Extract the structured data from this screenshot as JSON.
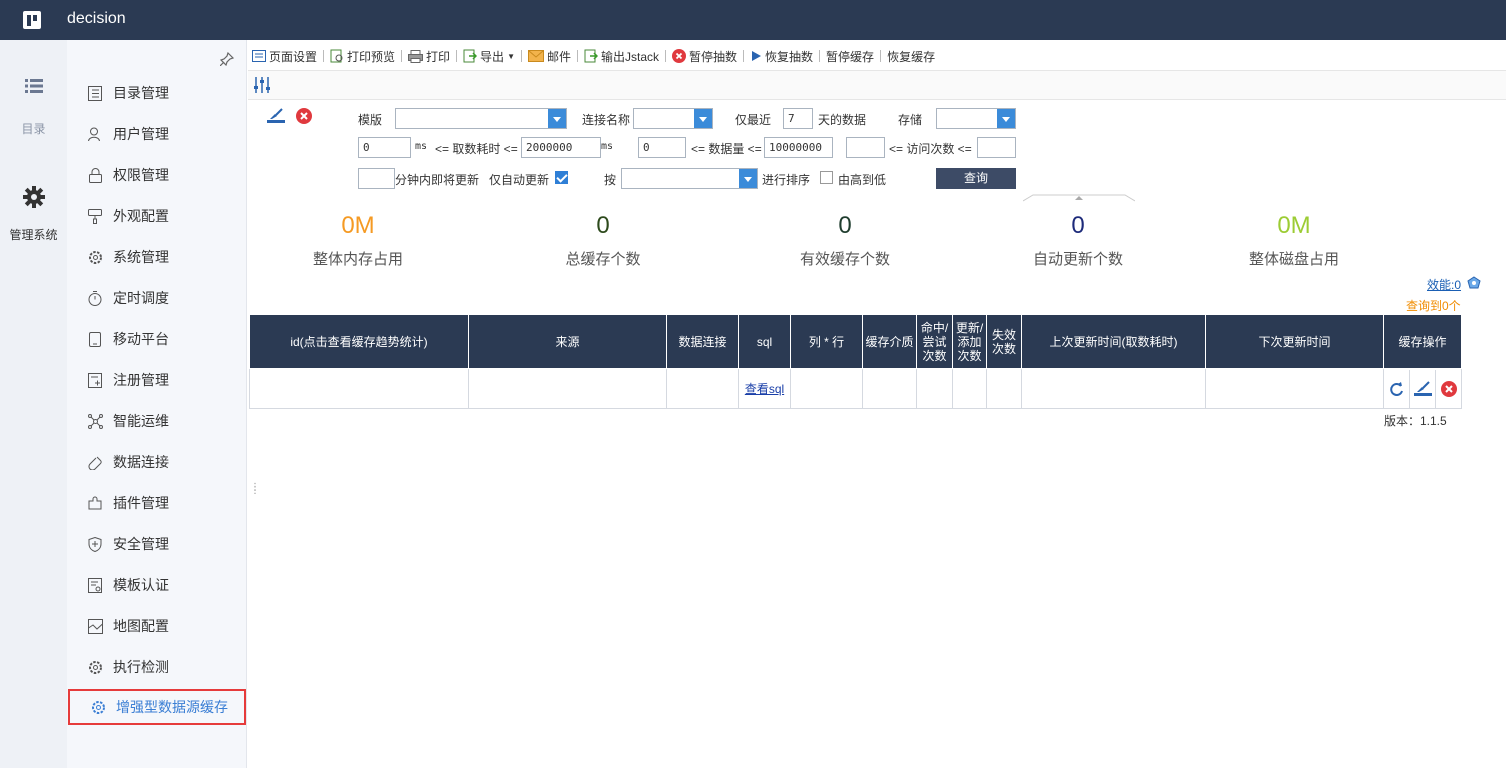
{
  "app": {
    "title": "decision"
  },
  "rail": [
    {
      "label": "目录",
      "icon": "list-icon"
    },
    {
      "label": "管理系统",
      "icon": "gear-icon"
    }
  ],
  "sidebar": {
    "items": [
      {
        "label": "目录管理",
        "icon": "catalog-icon"
      },
      {
        "label": "用户管理",
        "icon": "user-icon"
      },
      {
        "label": "权限管理",
        "icon": "lock-icon"
      },
      {
        "label": "外观配置",
        "icon": "brush-icon"
      },
      {
        "label": "系统管理",
        "icon": "settings-icon"
      },
      {
        "label": "定时调度",
        "icon": "timer-icon"
      },
      {
        "label": "移动平台",
        "icon": "mobile-icon"
      },
      {
        "label": "注册管理",
        "icon": "register-icon"
      },
      {
        "label": "智能运维",
        "icon": "ops-icon"
      },
      {
        "label": "数据连接",
        "icon": "link-icon"
      },
      {
        "label": "插件管理",
        "icon": "plugin-icon"
      },
      {
        "label": "安全管理",
        "icon": "shield-icon"
      },
      {
        "label": "模板认证",
        "icon": "template-cert-icon"
      },
      {
        "label": "地图配置",
        "icon": "map-icon"
      },
      {
        "label": "执行检测",
        "icon": "check-icon"
      },
      {
        "label": "增强型数据源缓存",
        "icon": "cache-icon",
        "active": true
      }
    ]
  },
  "toolbar": {
    "items": [
      {
        "label": "页面设置",
        "icon": "page-setup-icon"
      },
      {
        "label": "打印预览",
        "icon": "print-preview-icon"
      },
      {
        "label": "打印",
        "icon": "printer-icon"
      },
      {
        "label": "导出",
        "icon": "export-icon",
        "dropdown": true
      },
      {
        "label": "邮件",
        "icon": "mail-icon"
      },
      {
        "label": "输出Jstack",
        "icon": "jstack-icon"
      },
      {
        "label": "暂停抽数",
        "icon": "stop-icon"
      },
      {
        "label": "恢复抽数",
        "icon": "play-icon"
      },
      {
        "label": "暂停缓存",
        "icon": ""
      },
      {
        "label": "恢复缓存",
        "icon": ""
      }
    ]
  },
  "form": {
    "template_label": "模版",
    "template_value": "",
    "conn_label": "连接名称",
    "conn_value": "",
    "recent_label": "仅最近",
    "recent_days": "7",
    "days_suffix": "天的数据",
    "storage_label": "存储",
    "storage_value": "",
    "time_min": "0",
    "time_unit1": "ms",
    "time_mid": "<= 取数耗时 <=",
    "time_max": "2000000",
    "time_unit2": "ms",
    "rows_min": "0",
    "rows_mid": "<= 数据量 <=",
    "rows_max": "10000000",
    "visits_min": "",
    "visits_mid": "<= 访问次数 <=",
    "visits_max": "",
    "minutes_value": "",
    "minutes_label": "分钟内即将更新",
    "auto_only_label": "仅自动更新",
    "auto_only_checked": true,
    "sort_by_label": "按",
    "sort_by_value": "",
    "sort_label": "进行排序",
    "desc_label": "由高到低",
    "desc_checked": false,
    "query_button": "查询"
  },
  "stats": [
    {
      "value": "0M",
      "label": "整体内存占用",
      "color": "#f59a23"
    },
    {
      "value": "0",
      "label": "总缓存个数",
      "color": "#2d4a1c"
    },
    {
      "value": "0",
      "label": "有效缓存个数",
      "color": "#1f3d2e"
    },
    {
      "value": "0",
      "label": "自动更新个数",
      "color": "#1d2a7a"
    },
    {
      "value": "0M",
      "label": "整体磁盘占用",
      "color": "#9ccc34"
    }
  ],
  "efficiency_link": "效能:0",
  "query_count": "查询到0个",
  "table": {
    "columns": [
      "id(点击查看缓存趋势统计)",
      "来源",
      "数据连接",
      "sql",
      "列 * 行",
      "缓存介质",
      "命中/尝试次数",
      "更新/添加次数",
      "失效次数",
      "上次更新时间(取数耗时)",
      "下次更新时间",
      "缓存操作"
    ],
    "rows": [
      {
        "id": "",
        "source": "",
        "connection": "",
        "sql": "查看sql",
        "colrow": "",
        "medium": "",
        "hits": "",
        "updates": "",
        "invalid": "",
        "last": "",
        "next": ""
      }
    ]
  },
  "version": "版本：1.1.5"
}
